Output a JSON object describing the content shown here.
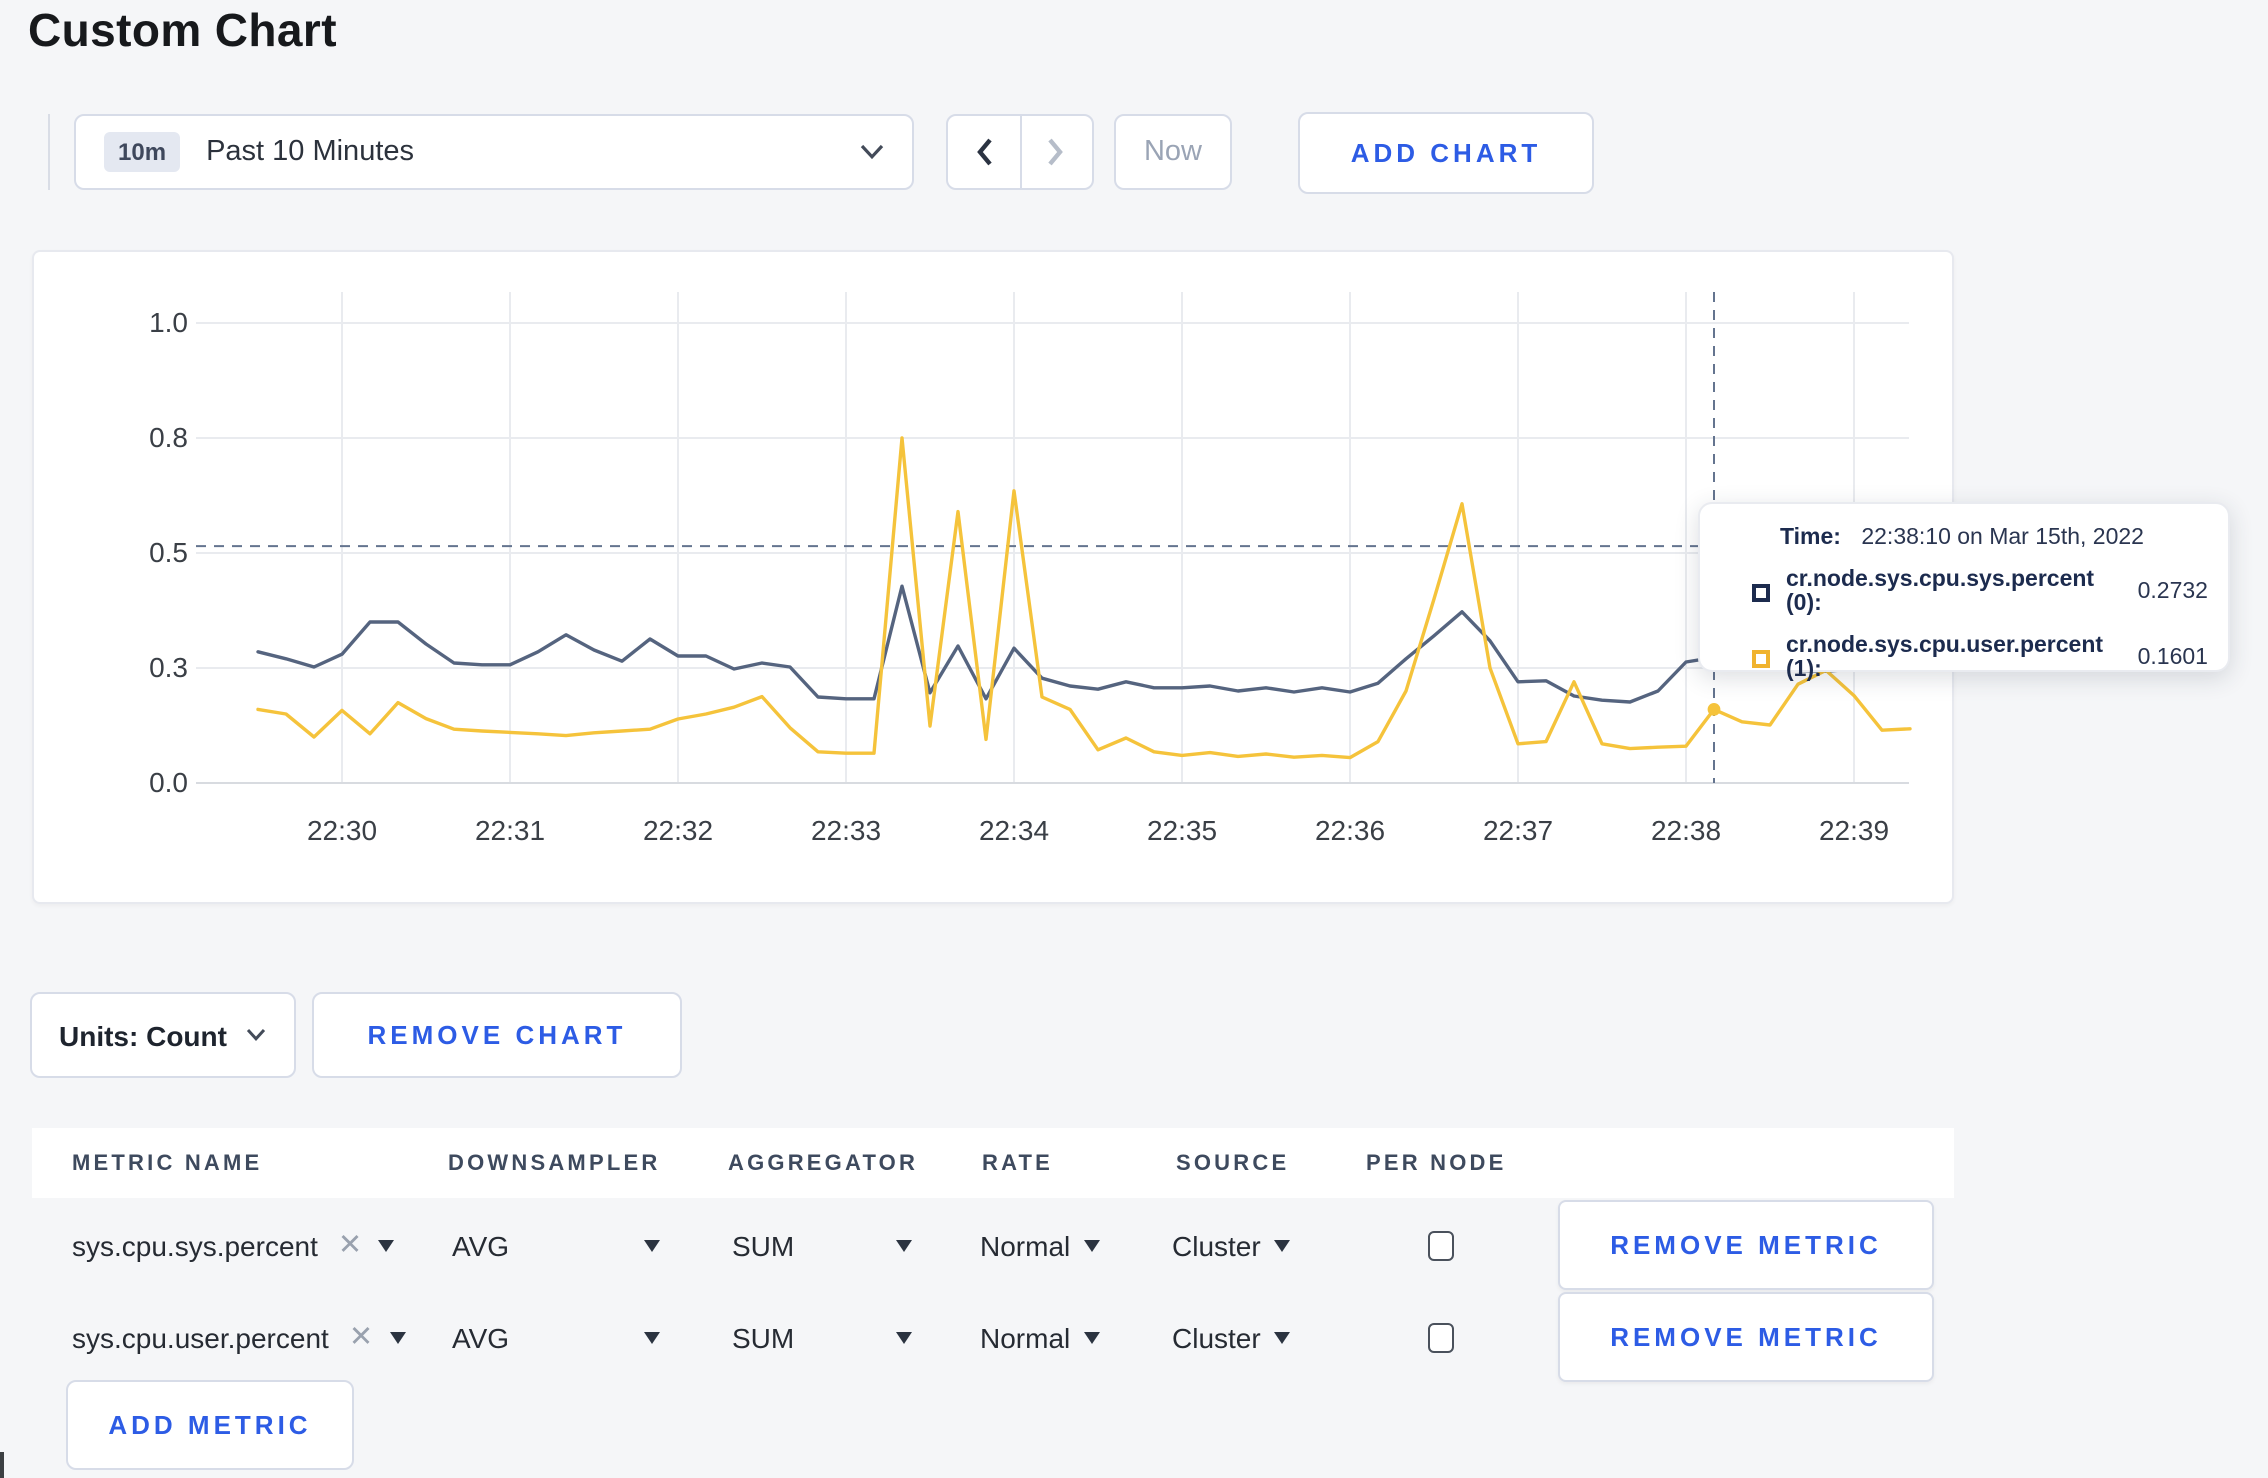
{
  "page": {
    "title": "Custom Chart",
    "background": "#f5f6f8",
    "accent_blue": "#2d5ce5"
  },
  "toolbar": {
    "time_window": {
      "badge": "10m",
      "label": "Past 10 Minutes"
    },
    "now_label": "Now",
    "add_chart_label": "ADD CHART"
  },
  "chart_controls": {
    "units_label": "Units: Count",
    "remove_chart_label": "REMOVE CHART"
  },
  "tooltip": {
    "time_label": "Time:",
    "time_value": "22:38:10 on Mar 15th, 2022",
    "rows": [
      {
        "name": "cr.node.sys.cpu.sys.percent (0):",
        "value": "0.2732",
        "color": "#1c2b4e"
      },
      {
        "name": "cr.node.sys.cpu.user.percent (1):",
        "value": "0.1601",
        "color": "#f0b32e"
      }
    ]
  },
  "metrics_table": {
    "columns": [
      "METRIC NAME",
      "DOWNSAMPLER",
      "AGGREGATOR",
      "RATE",
      "SOURCE",
      "PER NODE"
    ],
    "rows": [
      {
        "metric_name": "sys.cpu.sys.percent",
        "downsampler": "AVG",
        "aggregator": "SUM",
        "rate": "Normal",
        "source": "Cluster",
        "per_node": false,
        "remove_label": "REMOVE METRIC"
      },
      {
        "metric_name": "sys.cpu.user.percent",
        "downsampler": "AVG",
        "aggregator": "SUM",
        "rate": "Normal",
        "source": "Cluster",
        "per_node": false,
        "remove_label": "REMOVE METRIC"
      }
    ],
    "add_metric_label": "ADD METRIC"
  },
  "chart_data": {
    "type": "line",
    "title": "",
    "xlabel": "",
    "ylabel": "",
    "ylim": [
      0,
      1
    ],
    "grid": true,
    "legend_position": "tooltip",
    "y_ticks": [
      {
        "value": 0.0,
        "label": "0.0"
      },
      {
        "value": 0.25,
        "label": "0.3"
      },
      {
        "value": 0.5,
        "label": "0.5"
      },
      {
        "value": 0.75,
        "label": "0.8"
      },
      {
        "value": 1.0,
        "label": "1.0"
      }
    ],
    "x_tick_labels": [
      "22:30",
      "22:31",
      "22:32",
      "22:33",
      "22:34",
      "22:35",
      "22:36",
      "22:37",
      "22:38",
      "22:39"
    ],
    "x_times": [
      "22:29:30",
      "22:29:40",
      "22:29:50",
      "22:30:00",
      "22:30:10",
      "22:30:20",
      "22:30:30",
      "22:30:40",
      "22:30:50",
      "22:31:00",
      "22:31:10",
      "22:31:20",
      "22:31:30",
      "22:31:40",
      "22:31:50",
      "22:32:00",
      "22:32:10",
      "22:32:20",
      "22:32:30",
      "22:32:40",
      "22:32:50",
      "22:33:00",
      "22:33:10",
      "22:33:20",
      "22:33:30",
      "22:33:40",
      "22:33:50",
      "22:34:00",
      "22:34:10",
      "22:34:20",
      "22:34:30",
      "22:34:40",
      "22:34:50",
      "22:35:00",
      "22:35:10",
      "22:35:20",
      "22:35:30",
      "22:35:40",
      "22:35:50",
      "22:36:00",
      "22:36:10",
      "22:36:20",
      "22:36:30",
      "22:36:40",
      "22:36:50",
      "22:37:00",
      "22:37:10",
      "22:37:20",
      "22:37:30",
      "22:37:40",
      "22:37:50",
      "22:38:00",
      "22:38:10",
      "22:38:20",
      "22:38:30",
      "22:38:40",
      "22:38:50",
      "22:39:00",
      "22:39:10",
      "22:39:20"
    ],
    "series": [
      {
        "name": "cr.node.sys.cpu.sys.percent",
        "color": "#55647f",
        "values": [
          0.285,
          0.27,
          0.252,
          0.28,
          0.35,
          0.35,
          0.302,
          0.261,
          0.257,
          0.257,
          0.285,
          0.322,
          0.289,
          0.265,
          0.313,
          0.276,
          0.276,
          0.248,
          0.261,
          0.252,
          0.187,
          0.183,
          0.183,
          0.428,
          0.196,
          0.298,
          0.183,
          0.293,
          0.228,
          0.211,
          0.204,
          0.22,
          0.207,
          0.207,
          0.211,
          0.2,
          0.207,
          0.198,
          0.207,
          0.198,
          0.217,
          0.27,
          0.32,
          0.372,
          0.309,
          0.22,
          0.222,
          0.189,
          0.18,
          0.176,
          0.2,
          0.263,
          0.2732,
          0.248,
          0.262,
          0.245,
          0.243,
          0.248,
          0.252,
          0.27
        ]
      },
      {
        "name": "cr.node.sys.cpu.user.percent",
        "color": "#f5c33b",
        "values": [
          0.16,
          0.15,
          0.1,
          0.158,
          0.107,
          0.175,
          0.14,
          0.117,
          0.113,
          0.11,
          0.107,
          0.103,
          0.109,
          0.113,
          0.117,
          0.139,
          0.15,
          0.165,
          0.188,
          0.12,
          0.068,
          0.065,
          0.065,
          0.75,
          0.124,
          0.59,
          0.095,
          0.635,
          0.187,
          0.16,
          0.072,
          0.098,
          0.068,
          0.06,
          0.066,
          0.058,
          0.063,
          0.056,
          0.06,
          0.055,
          0.09,
          0.2,
          0.4,
          0.607,
          0.25,
          0.085,
          0.09,
          0.22,
          0.085,
          0.075,
          0.078,
          0.08,
          0.1601,
          0.133,
          0.126,
          0.215,
          0.245,
          0.19,
          0.115,
          0.118
        ]
      }
    ],
    "crosshair": {
      "time": "22:38:10",
      "h_line_value": 0.515,
      "highlight_points": [
        {
          "series": 0,
          "value": 0.2732
        },
        {
          "series": 1,
          "value": 0.1601
        }
      ]
    }
  }
}
